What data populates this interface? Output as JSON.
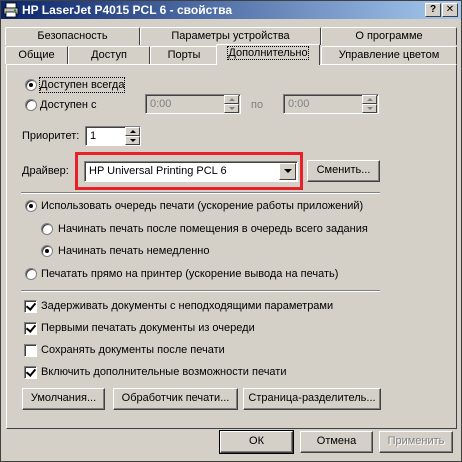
{
  "window": {
    "title": "HP LaserJet P4015 PCL 6 - свойства",
    "help_label": "?",
    "close_label": "✕"
  },
  "tabs": {
    "row_top": [
      "Безопасность",
      "Параметры устройства",
      "О программе"
    ],
    "row_bottom": [
      "Общие",
      "Доступ",
      "Порты",
      "Дополнительно",
      "Управление цветом"
    ],
    "active": "Дополнительно"
  },
  "availability": {
    "always": "Доступен всегда",
    "from": "Доступен с",
    "to": "по",
    "from_time": "0:00",
    "to_time": "0:00"
  },
  "priority": {
    "label": "Приоритет:",
    "value": "1"
  },
  "driver": {
    "label": "Драйвер:",
    "value": "HP Universal Printing PCL 6",
    "change_button": "Сменить...",
    "highlight_color": "#e8202a"
  },
  "spool": {
    "use_spool": "Использовать очередь печати (ускорение работы приложений)",
    "start_after_last": "Начинать печать после помещения в очередь всего задания",
    "start_immediately": "Начинать печать немедленно",
    "print_direct": "Печатать прямо на принтер (ускорение вывода на печать)"
  },
  "options": {
    "hold_mismatched": "Задерживать документы с неподходящими параметрами",
    "spooled_first": "Первыми печатать документы из очереди",
    "keep_printed": "Сохранять документы после печати",
    "advanced_features": "Включить дополнительные возможности печати"
  },
  "panel_buttons": {
    "defaults": "Умолчания...",
    "processor": "Обработчик печати...",
    "separator": "Страница-разделитель..."
  },
  "dialog_buttons": {
    "ok": "ОК",
    "cancel": "Отмена",
    "apply": "Применить"
  },
  "colors": {
    "titlebar_start": "#0a246a",
    "titlebar_end": "#a6caf0",
    "face": "#d4d0c8"
  }
}
